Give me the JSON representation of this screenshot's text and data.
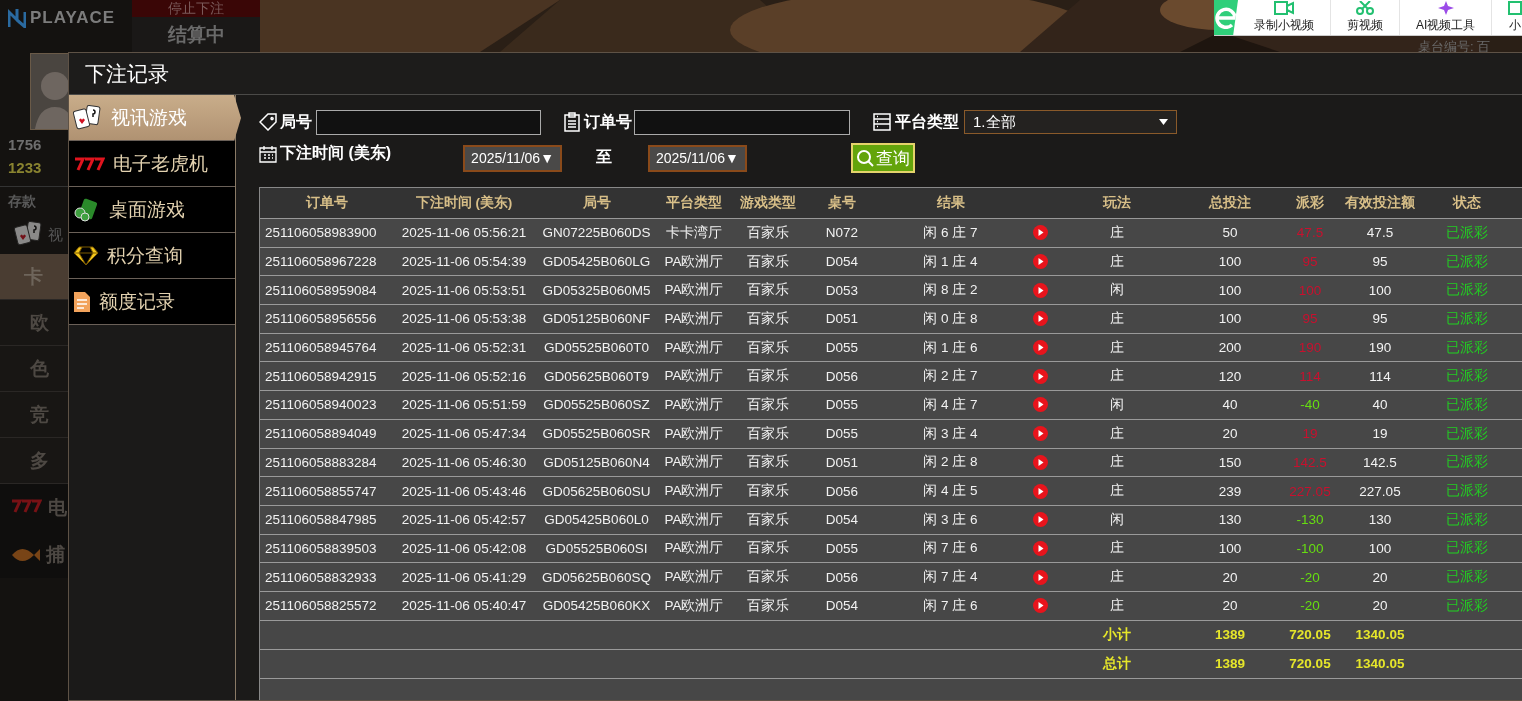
{
  "background": {
    "logo": "PLAYACE",
    "banner_status": "停止下注",
    "banner_state": "结算中",
    "table_label": "桌台编号: 百",
    "stats": [
      "1756",
      "1233"
    ],
    "deposit": "存款",
    "video_short": "视",
    "categories": [
      {
        "label": "卡",
        "selected": true
      },
      {
        "label": "欧",
        "selected": false
      },
      {
        "label": "色",
        "selected": false
      },
      {
        "label": "竞",
        "selected": false
      },
      {
        "label": "多",
        "selected": false
      }
    ],
    "sections": [
      {
        "kind": "slots",
        "label": "电"
      },
      {
        "kind": "fish",
        "label": "捕"
      }
    ]
  },
  "toolbar": {
    "items": [
      {
        "kind": "record",
        "label": "录制小视频"
      },
      {
        "kind": "cut",
        "label": "剪视频"
      },
      {
        "kind": "ai",
        "label": "AI视频工具"
      },
      {
        "kind": "small",
        "label": "小"
      }
    ]
  },
  "dialog": {
    "title": "下注记录",
    "nav": [
      {
        "kind": "cards",
        "label": "视讯游戏",
        "selected": true
      },
      {
        "kind": "slots",
        "label": "电子老虎机",
        "selected": false
      },
      {
        "kind": "chips",
        "label": "桌面游戏",
        "selected": false
      },
      {
        "kind": "diamond",
        "label": "积分查询",
        "selected": false
      },
      {
        "kind": "doc",
        "label": "额度记录",
        "selected": false
      }
    ],
    "filters": {
      "round_label": "局号",
      "order_label": "订单号",
      "platform_label": "平台类型",
      "platform_value": "1.全部",
      "time_label": "下注时间 (美东)",
      "date_from": "2025/11/06▼",
      "to_label": "至",
      "date_to": "2025/11/06▼",
      "query_button": "查询"
    },
    "table": {
      "columns": [
        "订单号",
        "下注时间 (美东)",
        "局号",
        "平台类型",
        "游戏类型",
        "桌号",
        "结果",
        "玩法",
        "总投注",
        "派彩",
        "有效投注额",
        "状态"
      ],
      "rows": [
        {
          "order_no": "251106058983900",
          "time": "2025-11-06 05:56:21",
          "round_no": "GN07225B060DS",
          "platform": "卡卡湾厅",
          "game": "百家乐",
          "table_no": "N072",
          "result": "闲 6 庄 7",
          "bet_on": "庄",
          "total_bet": "50",
          "payout": {
            "text": "47.5",
            "color": "#c8102e"
          },
          "valid_bet": "47.5",
          "status": "已派彩"
        },
        {
          "order_no": "251106058967228",
          "time": "2025-11-06 05:54:39",
          "round_no": "GD05425B060LG",
          "platform": "PA欧洲厅",
          "game": "百家乐",
          "table_no": "D054",
          "result": "闲 1 庄 4",
          "bet_on": "庄",
          "total_bet": "100",
          "payout": {
            "text": "95",
            "color": "#c8102e"
          },
          "valid_bet": "95",
          "status": "已派彩"
        },
        {
          "order_no": "251106058959084",
          "time": "2025-11-06 05:53:51",
          "round_no": "GD05325B060M5",
          "platform": "PA欧洲厅",
          "game": "百家乐",
          "table_no": "D053",
          "result": "闲 8 庄 2",
          "bet_on": "闲",
          "total_bet": "100",
          "payout": {
            "text": "100",
            "color": "#c8102e"
          },
          "valid_bet": "100",
          "status": "已派彩"
        },
        {
          "order_no": "251106058956556",
          "time": "2025-11-06 05:53:38",
          "round_no": "GD05125B060NF",
          "platform": "PA欧洲厅",
          "game": "百家乐",
          "table_no": "D051",
          "result": "闲 0 庄 8",
          "bet_on": "庄",
          "total_bet": "100",
          "payout": {
            "text": "95",
            "color": "#c8102e"
          },
          "valid_bet": "95",
          "status": "已派彩"
        },
        {
          "order_no": "251106058945764",
          "time": "2025-11-06 05:52:31",
          "round_no": "GD05525B060T0",
          "platform": "PA欧洲厅",
          "game": "百家乐",
          "table_no": "D055",
          "result": "闲 1 庄 6",
          "bet_on": "庄",
          "total_bet": "200",
          "payout": {
            "text": "190",
            "color": "#c8102e"
          },
          "valid_bet": "190",
          "status": "已派彩"
        },
        {
          "order_no": "251106058942915",
          "time": "2025-11-06 05:52:16",
          "round_no": "GD05625B060T9",
          "platform": "PA欧洲厅",
          "game": "百家乐",
          "table_no": "D056",
          "result": "闲 2 庄 7",
          "bet_on": "庄",
          "total_bet": "120",
          "payout": {
            "text": "114",
            "color": "#c8102e"
          },
          "valid_bet": "114",
          "status": "已派彩"
        },
        {
          "order_no": "251106058940023",
          "time": "2025-11-06 05:51:59",
          "round_no": "GD05525B060SZ",
          "platform": "PA欧洲厅",
          "game": "百家乐",
          "table_no": "D055",
          "result": "闲 4 庄 7",
          "bet_on": "闲",
          "total_bet": "40",
          "payout": {
            "text": "-40",
            "color": "#66dd11"
          },
          "valid_bet": "40",
          "status": "已派彩"
        },
        {
          "order_no": "251106058894049",
          "time": "2025-11-06 05:47:34",
          "round_no": "GD05525B060SR",
          "platform": "PA欧洲厅",
          "game": "百家乐",
          "table_no": "D055",
          "result": "闲 3 庄 4",
          "bet_on": "庄",
          "total_bet": "20",
          "payout": {
            "text": "19",
            "color": "#c8102e"
          },
          "valid_bet": "19",
          "status": "已派彩"
        },
        {
          "order_no": "251106058883284",
          "time": "2025-11-06 05:46:30",
          "round_no": "GD05125B060N4",
          "platform": "PA欧洲厅",
          "game": "百家乐",
          "table_no": "D051",
          "result": "闲 2 庄 8",
          "bet_on": "庄",
          "total_bet": "150",
          "payout": {
            "text": "142.5",
            "color": "#c8102e"
          },
          "valid_bet": "142.5",
          "status": "已派彩"
        },
        {
          "order_no": "251106058855747",
          "time": "2025-11-06 05:43:46",
          "round_no": "GD05625B060SU",
          "platform": "PA欧洲厅",
          "game": "百家乐",
          "table_no": "D056",
          "result": "闲 4 庄 5",
          "bet_on": "庄",
          "total_bet": "239",
          "payout": {
            "text": "227.05",
            "color": "#c8102e"
          },
          "valid_bet": "227.05",
          "status": "已派彩"
        },
        {
          "order_no": "251106058847985",
          "time": "2025-11-06 05:42:57",
          "round_no": "GD05425B060L0",
          "platform": "PA欧洲厅",
          "game": "百家乐",
          "table_no": "D054",
          "result": "闲 3 庄 6",
          "bet_on": "闲",
          "total_bet": "130",
          "payout": {
            "text": "-130",
            "color": "#66dd11"
          },
          "valid_bet": "130",
          "status": "已派彩"
        },
        {
          "order_no": "251106058839503",
          "time": "2025-11-06 05:42:08",
          "round_no": "GD05525B060SI",
          "platform": "PA欧洲厅",
          "game": "百家乐",
          "table_no": "D055",
          "result": "闲 7 庄 6",
          "bet_on": "庄",
          "total_bet": "100",
          "payout": {
            "text": "-100",
            "color": "#66dd11"
          },
          "valid_bet": "100",
          "status": "已派彩"
        },
        {
          "order_no": "251106058832933",
          "time": "2025-11-06 05:41:29",
          "round_no": "GD05625B060SQ",
          "platform": "PA欧洲厅",
          "game": "百家乐",
          "table_no": "D056",
          "result": "闲 7 庄 4",
          "bet_on": "庄",
          "total_bet": "20",
          "payout": {
            "text": "-20",
            "color": "#66dd11"
          },
          "valid_bet": "20",
          "status": "已派彩"
        },
        {
          "order_no": "251106058825572",
          "time": "2025-11-06 05:40:47",
          "round_no": "GD05425B060KX",
          "platform": "PA欧洲厅",
          "game": "百家乐",
          "table_no": "D054",
          "result": "闲 7 庄 6",
          "bet_on": "庄",
          "total_bet": "20",
          "payout": {
            "text": "-20",
            "color": "#66dd11"
          },
          "valid_bet": "20",
          "status": "已派彩"
        }
      ],
      "totals": [
        {
          "label": "小计",
          "total_bet": "1389",
          "payout": "720.05",
          "valid_bet": "1340.05"
        },
        {
          "label": "总计",
          "total_bet": "1389",
          "payout": "720.05",
          "valid_bet": "1340.05"
        }
      ]
    }
  }
}
